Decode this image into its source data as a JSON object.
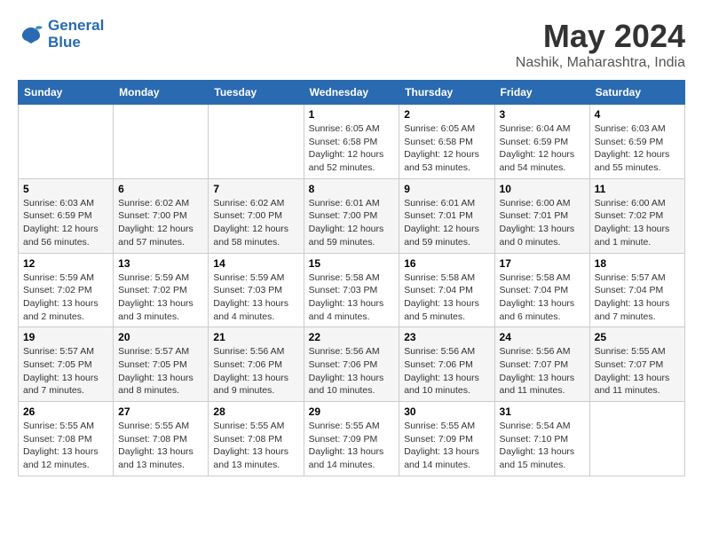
{
  "header": {
    "logo_line1": "General",
    "logo_line2": "Blue",
    "month": "May 2024",
    "location": "Nashik, Maharashtra, India"
  },
  "days_of_week": [
    "Sunday",
    "Monday",
    "Tuesday",
    "Wednesday",
    "Thursday",
    "Friday",
    "Saturday"
  ],
  "weeks": [
    [
      {
        "day": null,
        "sunrise": null,
        "sunset": null,
        "daylight": null
      },
      {
        "day": null,
        "sunrise": null,
        "sunset": null,
        "daylight": null
      },
      {
        "day": null,
        "sunrise": null,
        "sunset": null,
        "daylight": null
      },
      {
        "day": "1",
        "sunrise": "Sunrise: 6:05 AM",
        "sunset": "Sunset: 6:58 PM",
        "daylight": "Daylight: 12 hours and 52 minutes."
      },
      {
        "day": "2",
        "sunrise": "Sunrise: 6:05 AM",
        "sunset": "Sunset: 6:58 PM",
        "daylight": "Daylight: 12 hours and 53 minutes."
      },
      {
        "day": "3",
        "sunrise": "Sunrise: 6:04 AM",
        "sunset": "Sunset: 6:59 PM",
        "daylight": "Daylight: 12 hours and 54 minutes."
      },
      {
        "day": "4",
        "sunrise": "Sunrise: 6:03 AM",
        "sunset": "Sunset: 6:59 PM",
        "daylight": "Daylight: 12 hours and 55 minutes."
      }
    ],
    [
      {
        "day": "5",
        "sunrise": "Sunrise: 6:03 AM",
        "sunset": "Sunset: 6:59 PM",
        "daylight": "Daylight: 12 hours and 56 minutes."
      },
      {
        "day": "6",
        "sunrise": "Sunrise: 6:02 AM",
        "sunset": "Sunset: 7:00 PM",
        "daylight": "Daylight: 12 hours and 57 minutes."
      },
      {
        "day": "7",
        "sunrise": "Sunrise: 6:02 AM",
        "sunset": "Sunset: 7:00 PM",
        "daylight": "Daylight: 12 hours and 58 minutes."
      },
      {
        "day": "8",
        "sunrise": "Sunrise: 6:01 AM",
        "sunset": "Sunset: 7:00 PM",
        "daylight": "Daylight: 12 hours and 59 minutes."
      },
      {
        "day": "9",
        "sunrise": "Sunrise: 6:01 AM",
        "sunset": "Sunset: 7:01 PM",
        "daylight": "Daylight: 12 hours and 59 minutes."
      },
      {
        "day": "10",
        "sunrise": "Sunrise: 6:00 AM",
        "sunset": "Sunset: 7:01 PM",
        "daylight": "Daylight: 13 hours and 0 minutes."
      },
      {
        "day": "11",
        "sunrise": "Sunrise: 6:00 AM",
        "sunset": "Sunset: 7:02 PM",
        "daylight": "Daylight: 13 hours and 1 minute."
      }
    ],
    [
      {
        "day": "12",
        "sunrise": "Sunrise: 5:59 AM",
        "sunset": "Sunset: 7:02 PM",
        "daylight": "Daylight: 13 hours and 2 minutes."
      },
      {
        "day": "13",
        "sunrise": "Sunrise: 5:59 AM",
        "sunset": "Sunset: 7:02 PM",
        "daylight": "Daylight: 13 hours and 3 minutes."
      },
      {
        "day": "14",
        "sunrise": "Sunrise: 5:59 AM",
        "sunset": "Sunset: 7:03 PM",
        "daylight": "Daylight: 13 hours and 4 minutes."
      },
      {
        "day": "15",
        "sunrise": "Sunrise: 5:58 AM",
        "sunset": "Sunset: 7:03 PM",
        "daylight": "Daylight: 13 hours and 4 minutes."
      },
      {
        "day": "16",
        "sunrise": "Sunrise: 5:58 AM",
        "sunset": "Sunset: 7:04 PM",
        "daylight": "Daylight: 13 hours and 5 minutes."
      },
      {
        "day": "17",
        "sunrise": "Sunrise: 5:58 AM",
        "sunset": "Sunset: 7:04 PM",
        "daylight": "Daylight: 13 hours and 6 minutes."
      },
      {
        "day": "18",
        "sunrise": "Sunrise: 5:57 AM",
        "sunset": "Sunset: 7:04 PM",
        "daylight": "Daylight: 13 hours and 7 minutes."
      }
    ],
    [
      {
        "day": "19",
        "sunrise": "Sunrise: 5:57 AM",
        "sunset": "Sunset: 7:05 PM",
        "daylight": "Daylight: 13 hours and 7 minutes."
      },
      {
        "day": "20",
        "sunrise": "Sunrise: 5:57 AM",
        "sunset": "Sunset: 7:05 PM",
        "daylight": "Daylight: 13 hours and 8 minutes."
      },
      {
        "day": "21",
        "sunrise": "Sunrise: 5:56 AM",
        "sunset": "Sunset: 7:06 PM",
        "daylight": "Daylight: 13 hours and 9 minutes."
      },
      {
        "day": "22",
        "sunrise": "Sunrise: 5:56 AM",
        "sunset": "Sunset: 7:06 PM",
        "daylight": "Daylight: 13 hours and 10 minutes."
      },
      {
        "day": "23",
        "sunrise": "Sunrise: 5:56 AM",
        "sunset": "Sunset: 7:06 PM",
        "daylight": "Daylight: 13 hours and 10 minutes."
      },
      {
        "day": "24",
        "sunrise": "Sunrise: 5:56 AM",
        "sunset": "Sunset: 7:07 PM",
        "daylight": "Daylight: 13 hours and 11 minutes."
      },
      {
        "day": "25",
        "sunrise": "Sunrise: 5:55 AM",
        "sunset": "Sunset: 7:07 PM",
        "daylight": "Daylight: 13 hours and 11 minutes."
      }
    ],
    [
      {
        "day": "26",
        "sunrise": "Sunrise: 5:55 AM",
        "sunset": "Sunset: 7:08 PM",
        "daylight": "Daylight: 13 hours and 12 minutes."
      },
      {
        "day": "27",
        "sunrise": "Sunrise: 5:55 AM",
        "sunset": "Sunset: 7:08 PM",
        "daylight": "Daylight: 13 hours and 13 minutes."
      },
      {
        "day": "28",
        "sunrise": "Sunrise: 5:55 AM",
        "sunset": "Sunset: 7:08 PM",
        "daylight": "Daylight: 13 hours and 13 minutes."
      },
      {
        "day": "29",
        "sunrise": "Sunrise: 5:55 AM",
        "sunset": "Sunset: 7:09 PM",
        "daylight": "Daylight: 13 hours and 14 minutes."
      },
      {
        "day": "30",
        "sunrise": "Sunrise: 5:55 AM",
        "sunset": "Sunset: 7:09 PM",
        "daylight": "Daylight: 13 hours and 14 minutes."
      },
      {
        "day": "31",
        "sunrise": "Sunrise: 5:54 AM",
        "sunset": "Sunset: 7:10 PM",
        "daylight": "Daylight: 13 hours and 15 minutes."
      },
      {
        "day": null,
        "sunrise": null,
        "sunset": null,
        "daylight": null
      }
    ]
  ]
}
